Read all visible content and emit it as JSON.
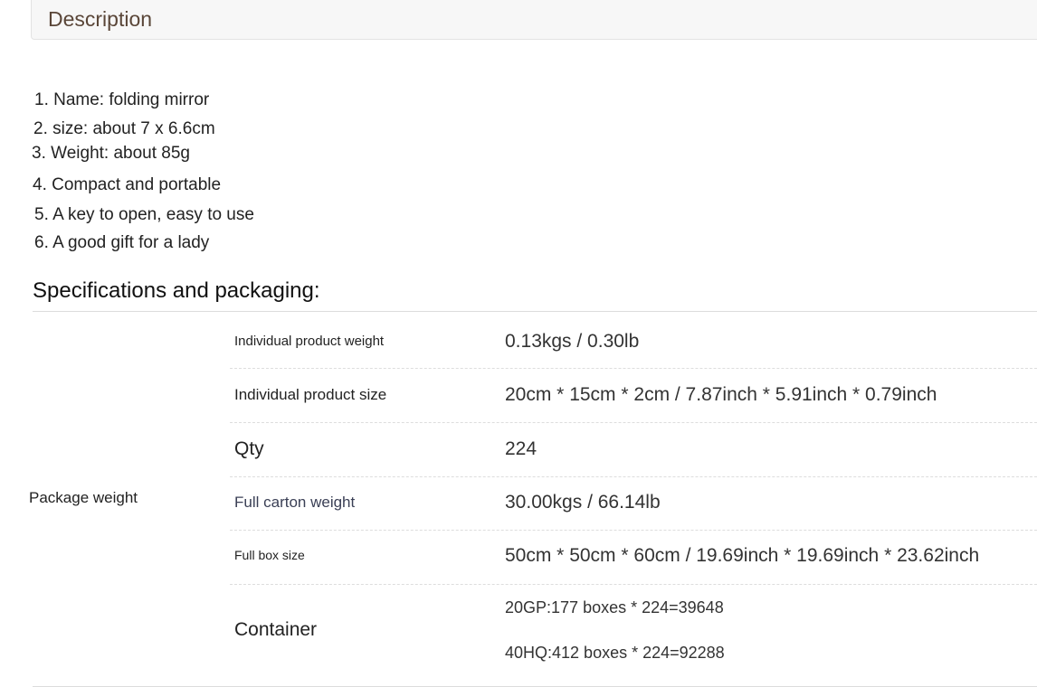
{
  "description": {
    "title": "Description",
    "items": [
      "1. Name: folding mirror",
      "2. size: about 7 x 6.6cm",
      "3. Weight: about 85g",
      "4. Compact and portable",
      "5. A key to open, easy to use",
      "6. A good gift for a lady"
    ]
  },
  "specs": {
    "heading": "Specifications and packaging:",
    "group_label": "Package weight",
    "rows": [
      {
        "label": "Individual product weight",
        "value": "0.13kgs / 0.30lb"
      },
      {
        "label": "Individual product size",
        "value": "20cm * 15cm * 2cm / 7.87inch * 5.91inch * 0.79inch"
      },
      {
        "label": "Qty",
        "value": "224"
      },
      {
        "label": "Full carton weight",
        "value": "30.00kgs / 66.14lb"
      },
      {
        "label": "Full box size",
        "value": "50cm * 50cm * 60cm / 19.69inch * 19.69inch * 23.62inch"
      },
      {
        "label": "Container",
        "values": [
          "20GP:177 boxes * 224=39648",
          "40HQ:412 boxes * 224=92288"
        ]
      }
    ]
  }
}
